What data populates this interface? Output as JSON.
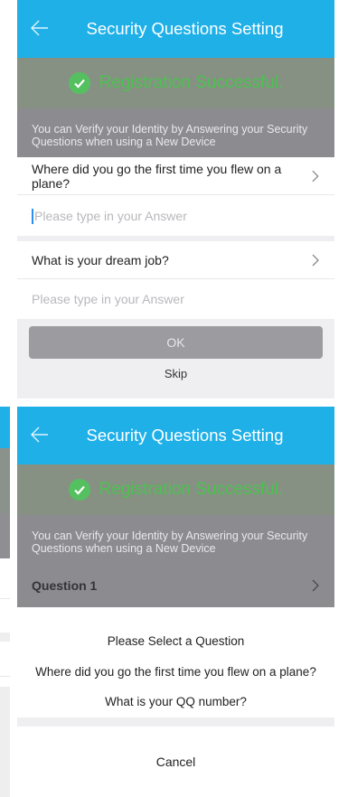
{
  "top_screen": {
    "header": {
      "title": "Security Questions Setting"
    },
    "success_message": "Registration Successful.",
    "info_text": "You can Verify your Identity by Answering your Security Questions when using a New Device",
    "questions": [
      {
        "question": "Where did you go the first time you flew on a plane?",
        "answer_placeholder": "Please type in your Answer"
      },
      {
        "question": "What is your dream job?",
        "answer_placeholder": "Please type in your Answer"
      }
    ],
    "ok_label": "OK",
    "skip_label": "Skip"
  },
  "bottom_screen": {
    "header": {
      "title": "Security Questions Setting"
    },
    "success_message": "Registration Successful.",
    "info_text": "You can Verify your Identity by Answering your Security Questions when using a New Device",
    "question_row_label": "Question 1",
    "picker": {
      "title": "Please Select a Question",
      "options": [
        "Where did you go the first time you flew on a plane?",
        "What is your QQ number?"
      ],
      "cancel_label": "Cancel"
    }
  },
  "colors": {
    "header": "#1fb0e8",
    "success_green": "#4bc24f",
    "overlay_gray": "#8c8c90"
  }
}
